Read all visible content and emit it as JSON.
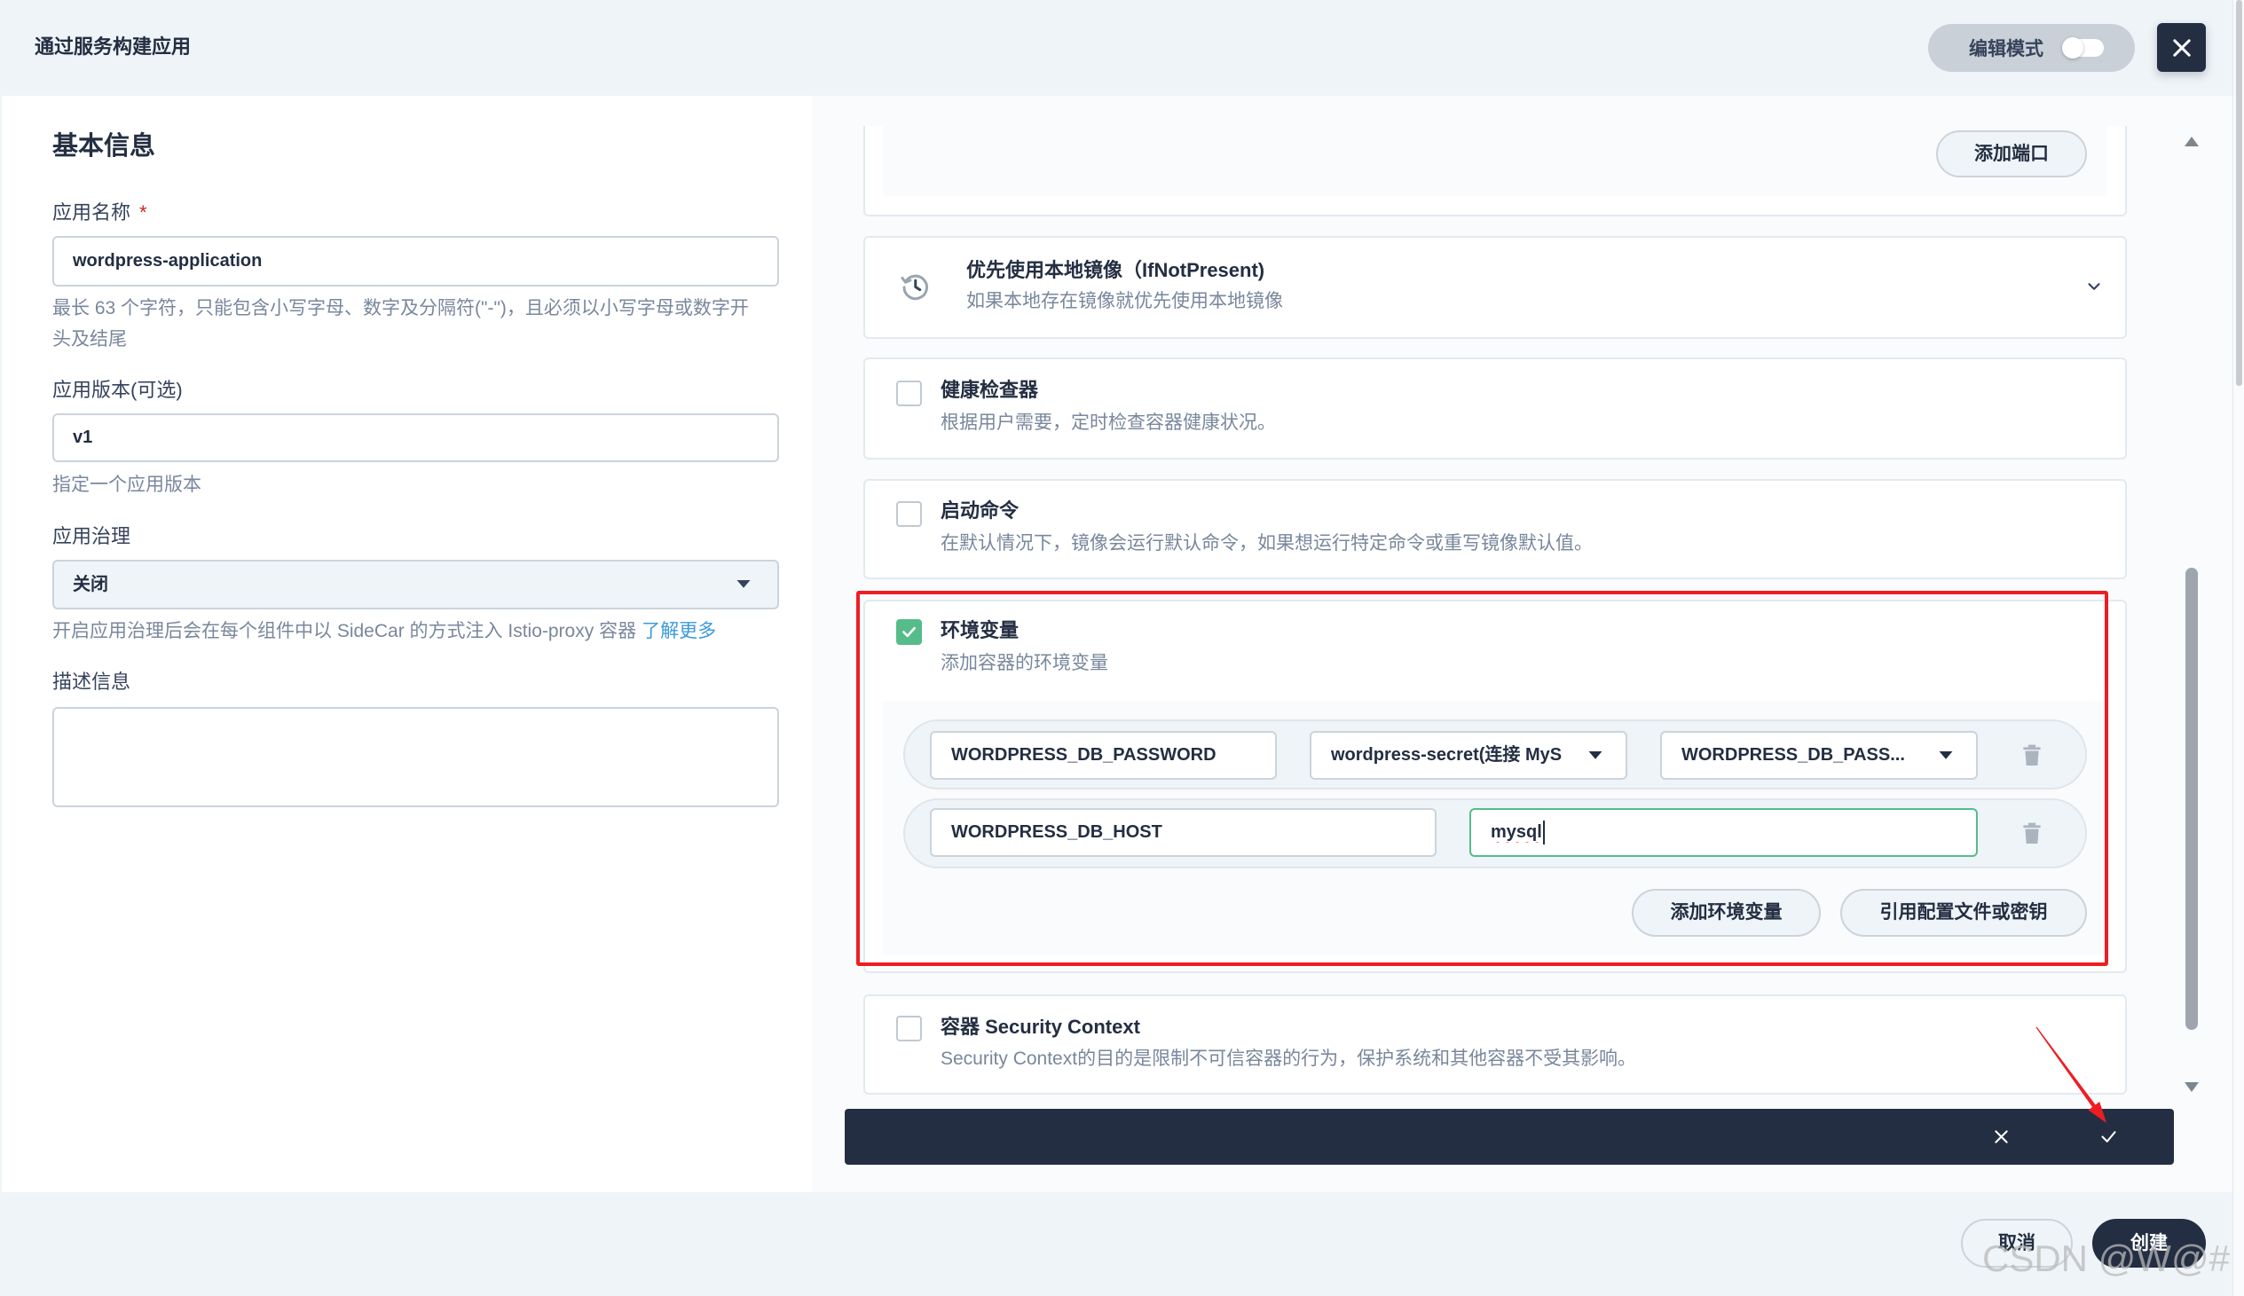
{
  "header": {
    "title": "通过服务构建应用",
    "edit_mode_label": "编辑模式",
    "edit_mode_enabled": false,
    "close_icon": "close-icon"
  },
  "basic_info": {
    "heading": "基本信息",
    "app_name": {
      "label": "应用名称",
      "required_mark": "*",
      "value": "wordpress-application",
      "help_lines": [
        "最长 63 个字符，只能包含小写字母、数字及分隔符(\"-\")，且必须以小写字母或数字开",
        "头及结尾"
      ]
    },
    "app_version": {
      "label": "应用版本(可选)",
      "value": "v1",
      "help": "指定一个应用版本"
    },
    "governance": {
      "label": "应用治理",
      "selected": "关闭",
      "help": "开启应用治理后会在每个组件中以 SideCar 的方式注入 Istio-proxy 容器",
      "help_link": "了解更多"
    },
    "description": {
      "label": "描述信息",
      "value": ""
    }
  },
  "container_settings": {
    "ports": {
      "add_port_button": "添加端口"
    },
    "image_pull_policy": {
      "icon": "history-icon",
      "title": "优先使用本地镜像（IfNotPresent)",
      "description": "如果本地存在镜像就优先使用本地镜像",
      "expand_icon": "chevron-down-icon"
    },
    "health_checker": {
      "checked": false,
      "title": "健康检查器",
      "description": "根据用户需要，定时检查容器健康状况。"
    },
    "start_command": {
      "checked": false,
      "title": "启动命令",
      "description": "在默认情况下，镜像会运行默认命令，如果想运行特定命令或重写镜像默认值。"
    },
    "env_vars": {
      "checked": true,
      "title": "环境变量",
      "description": "添加容器的环境变量",
      "rows": [
        {
          "name": "WORDPRESS_DB_PASSWORD",
          "source": "wordpress-secret(连接 MyS",
          "key": "WORDPRESS_DB_PASS..."
        },
        {
          "name": "WORDPRESS_DB_HOST",
          "value": "mysql"
        }
      ],
      "delete_icon": "trash-icon",
      "add_env_button": "添加环境变量",
      "use_config_button": "引用配置文件或密钥"
    },
    "security_context": {
      "checked": false,
      "title": "容器 Security Context",
      "description": "Security Context的目的是限制不可信容器的行为，保护系统和其他容器不受其影响。"
    }
  },
  "action_bar": {
    "cancel_icon": "close-icon",
    "confirm_icon": "check-icon"
  },
  "footer": {
    "cancel_button": "取消",
    "create_button": "创建"
  },
  "watermark": "CSDN @W@#",
  "colors": {
    "primary_dark": "#242e42",
    "success_green": "#55bc8a",
    "link_blue": "#3b99d9",
    "required_red": "#ca2621",
    "annotation_red": "#ee1d23"
  }
}
